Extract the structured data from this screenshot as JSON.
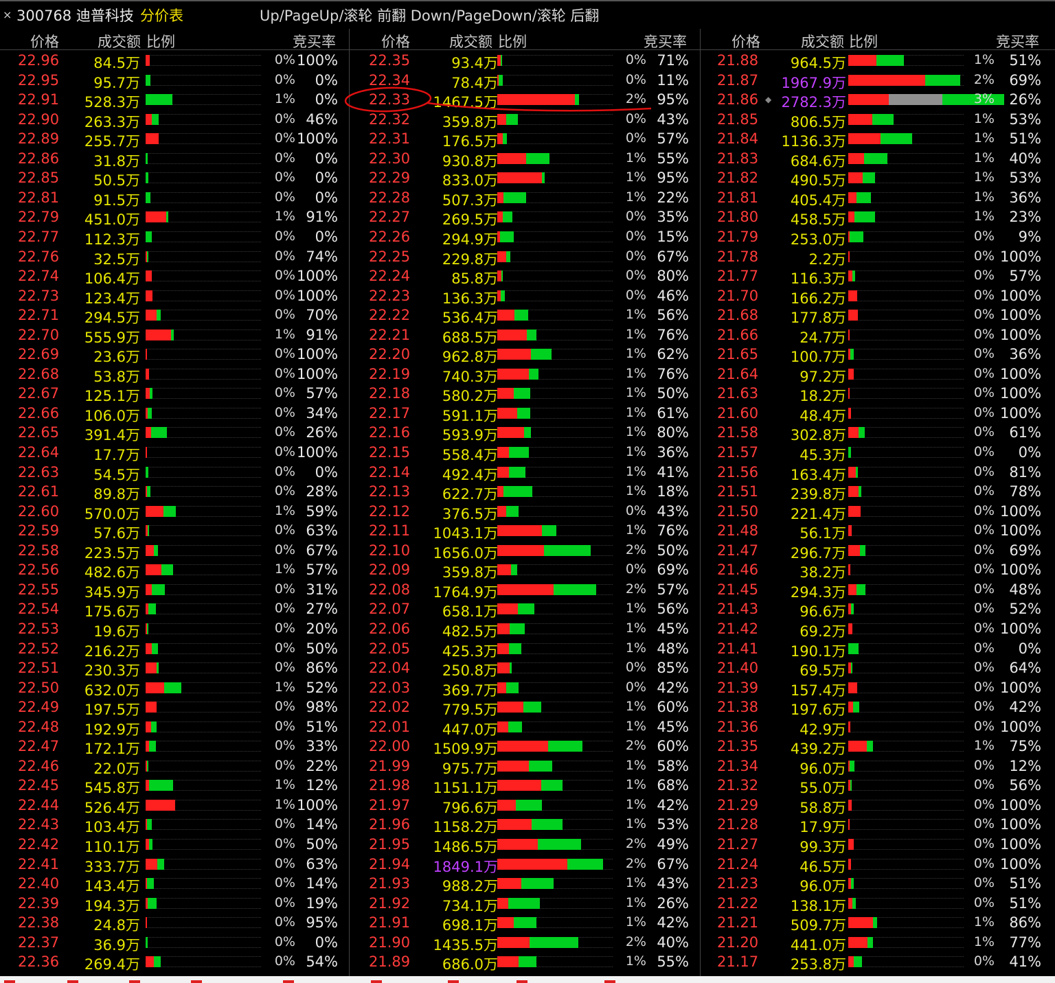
{
  "title": {
    "close_glyph": "×",
    "code_name": "300768 迪普科技",
    "table_name": "分价表",
    "hint": "Up/PageUp/滚轮 前翻 Down/PageDown/滚轮 后翻"
  },
  "headers": {
    "price": "价格",
    "amount": "成交额",
    "ratio": "比例",
    "rate": "竞买率"
  },
  "colors": {
    "red": "#ff2020",
    "green": "#00d020",
    "yellow": "#e6e600",
    "purple": "#c040ff"
  },
  "columns": [
    {
      "rows": [
        [
          "22.96",
          "84.5万",
          "0%",
          "100%",
          0.6,
          0.0
        ],
        [
          "22.95",
          "95.7万",
          "0%",
          "0%",
          0.0,
          0.7
        ],
        [
          "22.91",
          "528.3万",
          "1%",
          "0%",
          0.0,
          3.9
        ],
        [
          "22.90",
          "263.3万",
          "0%",
          "46%",
          0.9,
          1.0
        ],
        [
          "22.89",
          "255.7万",
          "0%",
          "100%",
          1.9,
          0.0
        ],
        [
          "22.86",
          "31.8万",
          "0%",
          "0%",
          0.0,
          0.3
        ],
        [
          "22.85",
          "50.5万",
          "0%",
          "0%",
          0.0,
          0.4
        ],
        [
          "22.81",
          "91.5万",
          "0%",
          "0%",
          0.0,
          0.7
        ],
        [
          "22.79",
          "451.0万",
          "1%",
          "91%",
          3.0,
          0.3
        ],
        [
          "22.77",
          "112.3万",
          "0%",
          "0%",
          0.0,
          0.9
        ],
        [
          "22.76",
          "32.5万",
          "0%",
          "74%",
          0.2,
          0.1
        ],
        [
          "22.74",
          "106.4万",
          "0%",
          "100%",
          0.9,
          0.0
        ],
        [
          "22.73",
          "123.4万",
          "0%",
          "100%",
          1.0,
          0.0
        ],
        [
          "22.71",
          "294.5万",
          "0%",
          "70%",
          1.6,
          0.6
        ],
        [
          "22.70",
          "555.9万",
          "1%",
          "91%",
          3.7,
          0.4
        ],
        [
          "22.69",
          "23.6万",
          "0%",
          "100%",
          0.2,
          0.0
        ],
        [
          "22.68",
          "53.8万",
          "0%",
          "100%",
          0.5,
          0.0
        ],
        [
          "22.67",
          "125.1万",
          "0%",
          "57%",
          0.6,
          0.4
        ],
        [
          "22.66",
          "106.0万",
          "0%",
          "34%",
          0.3,
          0.6
        ],
        [
          "22.65",
          "391.4万",
          "0%",
          "26%",
          0.8,
          2.3
        ],
        [
          "22.64",
          "17.7万",
          "0%",
          "100%",
          0.1,
          0.0
        ],
        [
          "22.63",
          "54.5万",
          "0%",
          "0%",
          0.0,
          0.4
        ],
        [
          "22.61",
          "89.8万",
          "0%",
          "28%",
          0.2,
          0.5
        ],
        [
          "22.60",
          "570.0万",
          "1%",
          "59%",
          2.6,
          1.8
        ],
        [
          "22.59",
          "57.6万",
          "0%",
          "63%",
          0.3,
          0.2
        ],
        [
          "22.58",
          "223.5万",
          "0%",
          "67%",
          1.2,
          0.6
        ],
        [
          "22.56",
          "482.6万",
          "1%",
          "57%",
          2.3,
          1.7
        ],
        [
          "22.55",
          "345.9万",
          "0%",
          "31%",
          0.9,
          1.9
        ],
        [
          "22.54",
          "175.6万",
          "0%",
          "27%",
          0.4,
          1.1
        ],
        [
          "22.53",
          "19.6万",
          "0%",
          "20%",
          0.1,
          0.1
        ],
        [
          "22.52",
          "216.2万",
          "0%",
          "50%",
          0.9,
          0.9
        ],
        [
          "22.51",
          "230.3万",
          "0%",
          "86%",
          1.6,
          0.3
        ],
        [
          "22.50",
          "632.0万",
          "1%",
          "52%",
          2.7,
          2.5
        ],
        [
          "22.49",
          "197.5万",
          "0%",
          "98%",
          1.6,
          0.0
        ],
        [
          "22.48",
          "192.9万",
          "0%",
          "51%",
          0.8,
          0.8
        ],
        [
          "22.47",
          "172.1万",
          "0%",
          "33%",
          0.5,
          1.0
        ],
        [
          "22.46",
          "22.0万",
          "0%",
          "22%",
          0.1,
          0.1
        ],
        [
          "22.45",
          "545.8万",
          "1%",
          "12%",
          0.5,
          3.5
        ],
        [
          "22.44",
          "526.4万",
          "1%",
          "100%",
          4.3,
          0.0
        ],
        [
          "22.43",
          "103.4万",
          "0%",
          "14%",
          0.1,
          0.7
        ],
        [
          "22.42",
          "110.1万",
          "0%",
          "50%",
          0.5,
          0.5
        ],
        [
          "22.41",
          "333.7万",
          "0%",
          "63%",
          1.7,
          1.0
        ],
        [
          "22.40",
          "143.4万",
          "0%",
          "14%",
          0.2,
          1.0
        ],
        [
          "22.39",
          "194.3万",
          "0%",
          "19%",
          0.3,
          1.3
        ],
        [
          "22.38",
          "24.8万",
          "0%",
          "95%",
          0.2,
          0.0
        ],
        [
          "22.37",
          "36.9万",
          "0%",
          "0%",
          0.0,
          0.3
        ],
        [
          "22.36",
          "269.4万",
          "0%",
          "54%",
          1.2,
          1.0
        ]
      ]
    },
    {
      "rows": [
        [
          "22.35",
          "93.4万",
          "0%",
          "71%",
          0.5,
          0.2
        ],
        [
          "22.34",
          "78.4万",
          "0%",
          "11%",
          0.1,
          0.6
        ],
        [
          "22.33",
          "1467.5万",
          "2%",
          "95%",
          11.3,
          0.6
        ],
        [
          "22.32",
          "359.8万",
          "0%",
          "43%",
          1.3,
          1.7
        ],
        [
          "22.31",
          "176.5万",
          "0%",
          "57%",
          0.8,
          0.6
        ],
        [
          "22.30",
          "930.8万",
          "1%",
          "55%",
          4.2,
          3.4
        ],
        [
          "22.29",
          "833.0万",
          "1%",
          "95%",
          6.5,
          0.4
        ],
        [
          "22.28",
          "507.3万",
          "1%",
          "22%",
          0.9,
          3.3
        ],
        [
          "22.27",
          "269.5万",
          "0%",
          "35%",
          0.8,
          1.4
        ],
        [
          "22.26",
          "294.9万",
          "0%",
          "15%",
          0.4,
          2.0
        ],
        [
          "22.25",
          "229.8万",
          "0%",
          "67%",
          1.3,
          0.6
        ],
        [
          "22.24",
          "85.8万",
          "0%",
          "80%",
          0.6,
          0.1
        ],
        [
          "22.23",
          "136.3万",
          "0%",
          "46%",
          0.5,
          0.6
        ],
        [
          "22.22",
          "536.4万",
          "1%",
          "56%",
          2.5,
          2.0
        ],
        [
          "22.21",
          "688.5万",
          "1%",
          "76%",
          4.3,
          1.4
        ],
        [
          "22.20",
          "962.8万",
          "1%",
          "62%",
          4.9,
          3.0
        ],
        [
          "22.19",
          "740.3万",
          "1%",
          "76%",
          4.6,
          1.4
        ],
        [
          "22.18",
          "580.2万",
          "1%",
          "50%",
          2.4,
          2.4
        ],
        [
          "22.17",
          "591.1万",
          "1%",
          "61%",
          2.9,
          1.9
        ],
        [
          "22.16",
          "593.9万",
          "1%",
          "80%",
          3.9,
          1.0
        ],
        [
          "22.15",
          "558.4万",
          "1%",
          "36%",
          1.7,
          2.9
        ],
        [
          "22.14",
          "492.4万",
          "1%",
          "41%",
          1.7,
          2.4
        ],
        [
          "22.13",
          "622.7万",
          "1%",
          "18%",
          0.9,
          4.2
        ],
        [
          "22.12",
          "376.5万",
          "0%",
          "43%",
          1.3,
          1.8
        ],
        [
          "22.11",
          "1043.1万",
          "1%",
          "76%",
          6.5,
          2.1
        ],
        [
          "22.10",
          "1656.0万",
          "2%",
          "50%",
          6.8,
          6.8
        ],
        [
          "22.09",
          "359.8万",
          "0%",
          "69%",
          2.0,
          0.9
        ],
        [
          "22.08",
          "1764.9万",
          "2%",
          "57%",
          8.2,
          6.2
        ],
        [
          "22.07",
          "658.1万",
          "1%",
          "56%",
          3.0,
          2.4
        ],
        [
          "22.06",
          "482.5万",
          "1%",
          "45%",
          1.8,
          2.2
        ],
        [
          "22.05",
          "425.3万",
          "1%",
          "48%",
          1.7,
          1.8
        ],
        [
          "22.04",
          "250.8万",
          "0%",
          "85%",
          1.8,
          0.3
        ],
        [
          "22.03",
          "369.7万",
          "0%",
          "42%",
          1.3,
          1.8
        ],
        [
          "22.02",
          "779.5万",
          "1%",
          "60%",
          3.8,
          2.6
        ],
        [
          "22.01",
          "447.0万",
          "1%",
          "45%",
          1.6,
          2.0
        ],
        [
          "22.00",
          "1509.9万",
          "2%",
          "60%",
          7.4,
          5.0
        ],
        [
          "21.99",
          "975.7万",
          "1%",
          "58%",
          4.6,
          3.4
        ],
        [
          "21.98",
          "1151.1万",
          "1%",
          "68%",
          6.4,
          3.1
        ],
        [
          "21.97",
          "796.6万",
          "1%",
          "42%",
          2.7,
          3.8
        ],
        [
          "21.96",
          "1158.2万",
          "1%",
          "53%",
          5.0,
          4.5
        ],
        [
          "21.95",
          "1486.5万",
          "2%",
          "49%",
          5.9,
          6.3
        ],
        [
          "21.94",
          "1849.1万",
          "2%",
          "67%",
          10.2,
          5.2
        ],
        [
          "21.93",
          "988.2万",
          "1%",
          "43%",
          3.5,
          4.7
        ],
        [
          "21.92",
          "734.1万",
          "1%",
          "26%",
          1.6,
          4.6
        ],
        [
          "21.91",
          "698.1万",
          "1%",
          "42%",
          2.4,
          3.3
        ],
        [
          "21.90",
          "1435.5万",
          "2%",
          "40%",
          4.7,
          7.1
        ],
        [
          "21.89",
          "686.0万",
          "1%",
          "55%",
          3.1,
          2.6
        ]
      ]
    },
    {
      "rows": [
        [
          "21.88",
          "964.5万",
          "1%",
          "51%",
          4.1,
          4.0
        ],
        [
          "21.87",
          "1967.9万",
          "2%",
          "69%",
          11.2,
          5.1
        ],
        [
          "21.86",
          "2782.3万",
          "3%",
          "26%",
          5.9,
          16.8
        ],
        [
          "21.85",
          "806.5万",
          "1%",
          "53%",
          3.5,
          3.1
        ],
        [
          "21.84",
          "1136.3万",
          "1%",
          "51%",
          4.7,
          4.6
        ],
        [
          "21.83",
          "684.6万",
          "1%",
          "40%",
          2.3,
          3.4
        ],
        [
          "21.82",
          "490.5万",
          "1%",
          "53%",
          2.1,
          1.8
        ],
        [
          "21.81",
          "405.4万",
          "1%",
          "36%",
          1.2,
          2.1
        ],
        [
          "21.80",
          "458.5万",
          "1%",
          "23%",
          0.9,
          3.0
        ],
        [
          "21.79",
          "253.0万",
          "0%",
          "9%",
          0.2,
          2.0
        ],
        [
          "21.78",
          "2.2万",
          "0%",
          "100%",
          0.1,
          0.0
        ],
        [
          "21.77",
          "116.3万",
          "0%",
          "57%",
          0.6,
          0.4
        ],
        [
          "21.70",
          "166.2万",
          "0%",
          "100%",
          1.3,
          0.0
        ],
        [
          "21.68",
          "177.8万",
          "0%",
          "100%",
          1.4,
          0.0
        ],
        [
          "21.66",
          "24.7万",
          "0%",
          "100%",
          0.2,
          0.0
        ],
        [
          "21.65",
          "100.7万",
          "0%",
          "36%",
          0.3,
          0.5
        ],
        [
          "21.64",
          "97.2万",
          "0%",
          "100%",
          0.8,
          0.0
        ],
        [
          "21.63",
          "18.2万",
          "0%",
          "100%",
          0.1,
          0.0
        ],
        [
          "21.60",
          "48.4万",
          "0%",
          "100%",
          0.4,
          0.0
        ],
        [
          "21.58",
          "302.8万",
          "0%",
          "61%",
          1.5,
          0.9
        ],
        [
          "21.57",
          "45.3万",
          "0%",
          "0%",
          0.0,
          0.4
        ],
        [
          "21.56",
          "163.4万",
          "0%",
          "81%",
          1.1,
          0.3
        ],
        [
          "21.51",
          "239.8万",
          "0%",
          "78%",
          1.5,
          0.4
        ],
        [
          "21.50",
          "221.4万",
          "0%",
          "100%",
          1.8,
          0.0
        ],
        [
          "21.48",
          "56.1万",
          "0%",
          "100%",
          0.5,
          0.0
        ],
        [
          "21.47",
          "296.7万",
          "0%",
          "69%",
          1.7,
          0.8
        ],
        [
          "21.46",
          "38.2万",
          "0%",
          "100%",
          0.3,
          0.0
        ],
        [
          "21.45",
          "294.3万",
          "0%",
          "48%",
          1.2,
          1.3
        ],
        [
          "21.43",
          "96.6万",
          "0%",
          "52%",
          0.4,
          0.4
        ],
        [
          "21.42",
          "69.2万",
          "0%",
          "100%",
          0.6,
          0.0
        ],
        [
          "21.41",
          "190.1万",
          "0%",
          "0%",
          0.0,
          1.5
        ],
        [
          "21.40",
          "69.5万",
          "0%",
          "64%",
          0.4,
          0.2
        ],
        [
          "21.39",
          "157.4万",
          "0%",
          "100%",
          1.3,
          0.0
        ],
        [
          "21.38",
          "197.6万",
          "0%",
          "42%",
          0.7,
          0.9
        ],
        [
          "21.36",
          "42.9万",
          "0%",
          "100%",
          0.3,
          0.0
        ],
        [
          "21.35",
          "439.2万",
          "1%",
          "75%",
          2.7,
          0.9
        ],
        [
          "21.34",
          "96.0万",
          "0%",
          "12%",
          0.1,
          0.7
        ],
        [
          "21.32",
          "55.0万",
          "0%",
          "56%",
          0.3,
          0.2
        ],
        [
          "21.29",
          "58.8万",
          "0%",
          "100%",
          0.5,
          0.0
        ],
        [
          "21.28",
          "17.9万",
          "0%",
          "100%",
          0.1,
          0.0
        ],
        [
          "21.27",
          "99.3万",
          "0%",
          "100%",
          0.8,
          0.0
        ],
        [
          "21.24",
          "46.5万",
          "0%",
          "100%",
          0.4,
          0.0
        ],
        [
          "21.23",
          "96.0万",
          "0%",
          "51%",
          0.4,
          0.4
        ],
        [
          "21.22",
          "138.1万",
          "0%",
          "51%",
          0.6,
          0.5
        ],
        [
          "21.21",
          "509.7万",
          "1%",
          "86%",
          3.6,
          0.6
        ],
        [
          "21.20",
          "441.0万",
          "1%",
          "77%",
          2.8,
          0.8
        ],
        [
          "21.17",
          "253.8万",
          "0%",
          "41%",
          0.8,
          1.2
        ]
      ]
    }
  ],
  "highlight_amounts": [
    "1967.9万",
    "2782.3万",
    "1849.1万"
  ],
  "marker_row_price": "21.86",
  "marker_glyph": "◆"
}
